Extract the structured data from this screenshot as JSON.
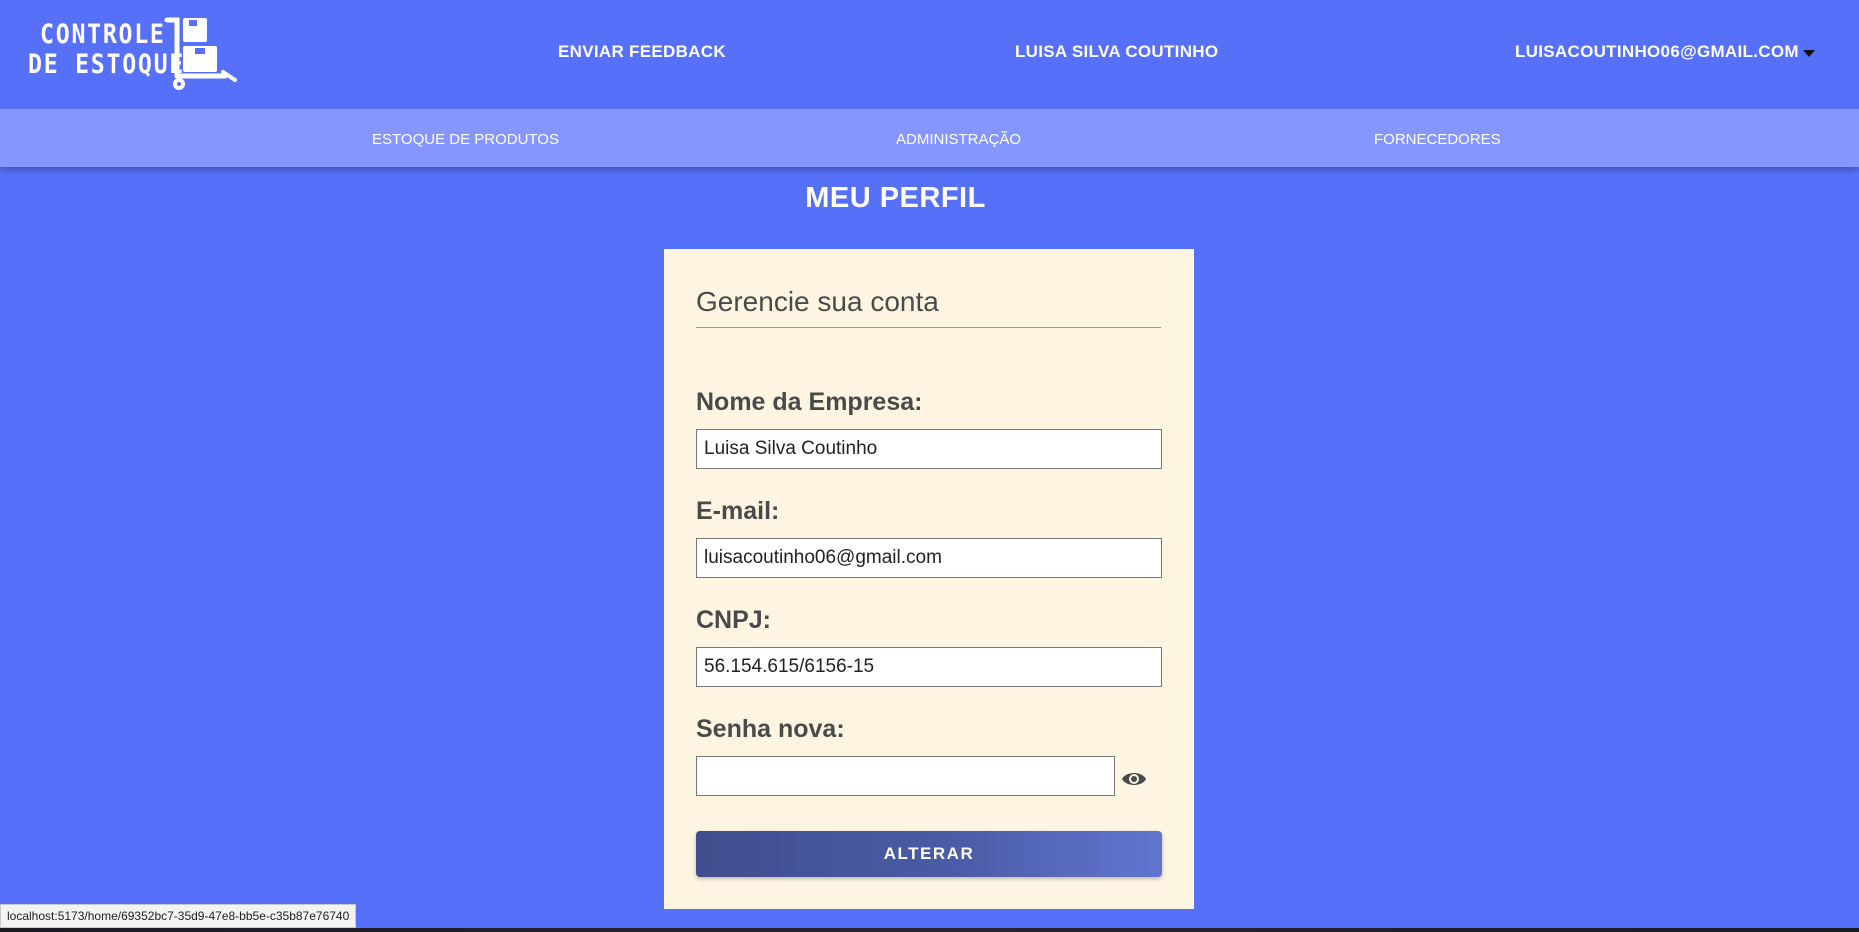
{
  "header": {
    "logo_line1": "CONTROLE",
    "logo_line2": "DE ESTOQUE",
    "feedback_link": "ENVIAR FEEDBACK",
    "user_name": "LUISA SILVA COUTINHO",
    "user_email": "LUISACOUTINHO06@GMAIL.COM"
  },
  "nav": {
    "items": [
      {
        "label": "ESTOQUE DE PRODUTOS"
      },
      {
        "label": "ADMINISTRAÇÃO"
      },
      {
        "label": "FORNECEDORES"
      }
    ]
  },
  "page": {
    "title": "MEU PERFIL"
  },
  "profile_form": {
    "heading": "Gerencie sua conta",
    "company_label": "Nome da Empresa:",
    "company_value": "Luisa Silva Coutinho",
    "email_label": "E-mail:",
    "email_value": "luisacoutinho06@gmail.com",
    "cnpj_label": "CNPJ:",
    "cnpj_value": "56.154.615/6156-15",
    "password_label": "Senha nova:",
    "password_value": "",
    "submit_label": "ALTERAR"
  },
  "status_bar": {
    "url": "localhost:5173/home/69352bc7-35d9-47e8-bb5e-c35b87e76740"
  },
  "icons": {
    "logo": "hand-truck-boxes-icon",
    "dropdown": "caret-down-icon",
    "password_toggle": "eye-icon"
  },
  "colors": {
    "background": "#5670fa",
    "subnav": "#8596ff",
    "card": "#fdf5e2",
    "button_start": "#3f4e8d",
    "button_end": "#6275d0"
  }
}
